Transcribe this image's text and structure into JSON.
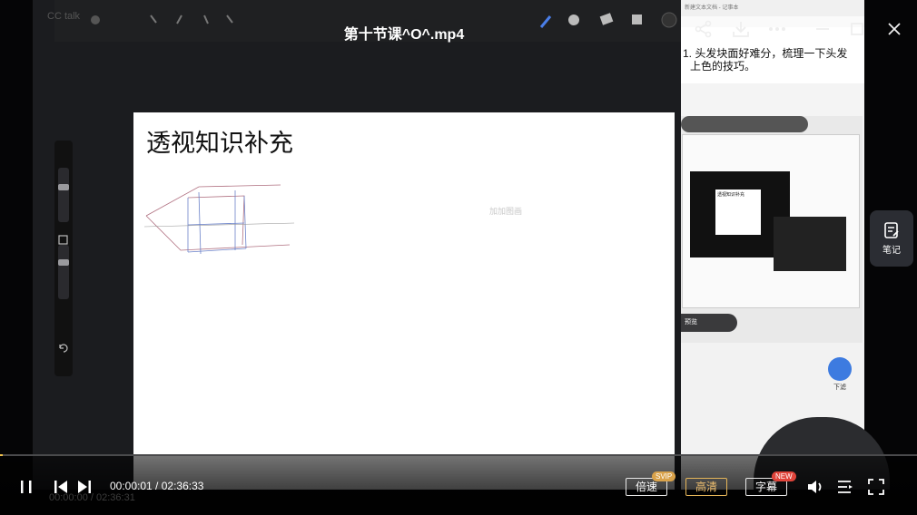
{
  "player": {
    "title": "第十节课^O^.mp4",
    "current_time": "00:00:01",
    "separator": " / ",
    "duration": "02:36:33",
    "speed_label": "倍速",
    "speed_badge": "SVIP",
    "quality_label": "高清",
    "subtitle_label": "字幕",
    "subtitle_badge": "NEW",
    "progress_fraction": 0.003
  },
  "side_panel": {
    "notes_label": "笔记"
  },
  "video_content": {
    "canvas_heading": "透视知识补充",
    "canvas_watermark": "加加图画",
    "notepad_line1": "1. 头发块面好难分，梳理一下头发",
    "notepad_line2": "上色的技巧。",
    "nested_heading": "透视知识补充",
    "nested_stop_label": "预览",
    "nested_next_label": "下滤",
    "faint_time": "00:00:00 / 02:36:31",
    "cc_label": "CC talk"
  },
  "colors": {
    "accent_gold": "#e6b65a",
    "badge_svip": "#d9a24a",
    "badge_new": "#e0443a",
    "notes_bg": "#2b2d33"
  }
}
